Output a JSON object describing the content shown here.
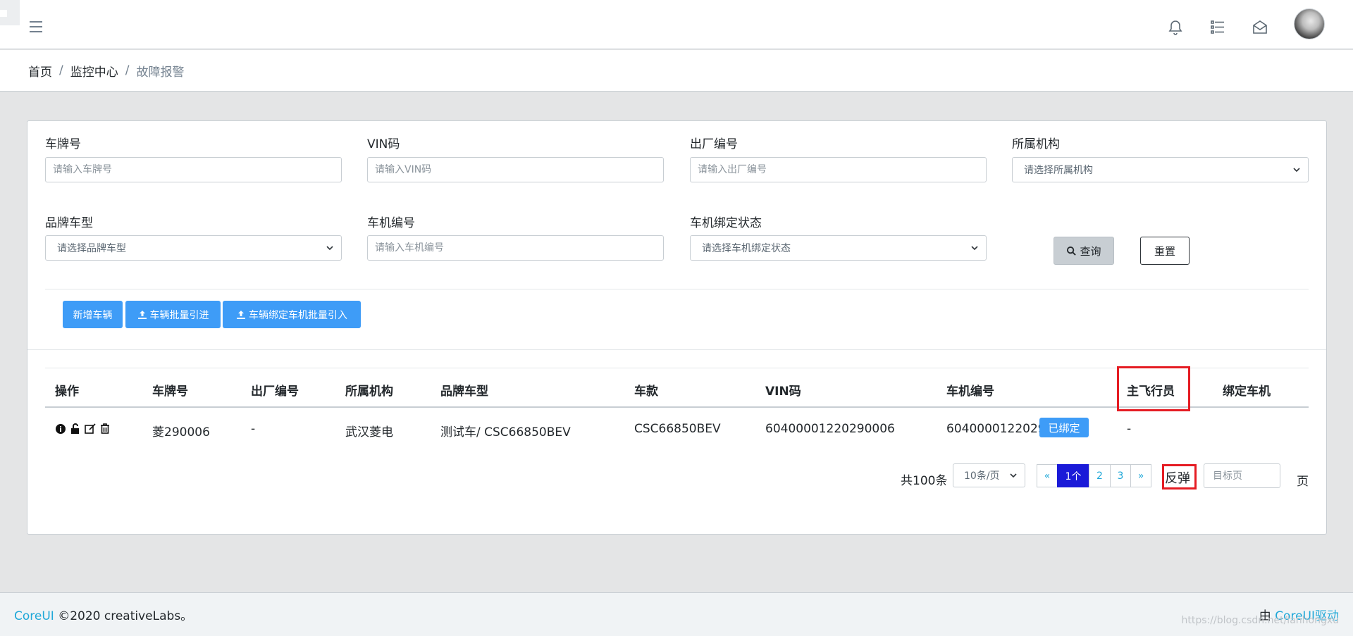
{
  "header": {
    "icons": [
      "menu-icon",
      "bell-icon",
      "list-icon",
      "envelope-icon"
    ]
  },
  "breadcrumb": {
    "home": "首页",
    "monitor": "监控中心",
    "current": "故障报警",
    "separator": "/"
  },
  "filters": {
    "plate": {
      "label": "车牌号",
      "placeholder": "请输入车牌号"
    },
    "vin": {
      "label": "VIN码",
      "placeholder": "请输入VIN码"
    },
    "factory_no": {
      "label": "出厂编号",
      "placeholder": "请输入出厂编号"
    },
    "org": {
      "label": "所属机构",
      "selected": "请选择所属机构"
    },
    "model": {
      "label": "品牌车型",
      "selected": "请选择品牌车型"
    },
    "device_no": {
      "label": "车机编号",
      "placeholder": "请输入车机编号"
    },
    "bind_status": {
      "label": "车机绑定状态",
      "selected": "请选择车机绑定状态"
    },
    "query_label": "查询",
    "reset_label": "重置"
  },
  "actions": {
    "add_vehicle": "新增车辆",
    "batch_import": "车辆批量引进",
    "bind_import": "车辆绑定车机批量引入"
  },
  "table": {
    "headers": {
      "ops": "操作",
      "plate": "车牌号",
      "factory_no": "出厂编号",
      "org": "所属机构",
      "model": "品牌车型",
      "style": "车款",
      "vin": "VIN码",
      "device_no": "车机编号",
      "pilot": "主飞行员",
      "bind": "绑定车机"
    },
    "rows": [
      {
        "plate": "菱290006",
        "factory_no": "-",
        "org": "武汉菱电",
        "model": "测试车/ CSC66850BEV",
        "style": "CSC66850BEV",
        "vin": "60400001220290006",
        "device_no": "60400001220290006",
        "pilot": "-",
        "bind": "已绑定"
      }
    ],
    "op_icons": [
      "info-icon",
      "unlock-icon",
      "edit-icon",
      "trash-icon"
    ]
  },
  "pagination": {
    "total": "共100条",
    "page_size": "10条/页",
    "prev": "«",
    "pages": [
      "1个",
      "2",
      "3"
    ],
    "next": "»",
    "rebound": "反弹",
    "goto_placeholder": "目标页",
    "suffix": "页"
  },
  "footer": {
    "brand": "CoreUI",
    "copyright": "©2020 creativeLabs。",
    "powered_prefix": "由",
    "powered_link": "CoreUI驱动"
  },
  "watermark": "https://blog.csdn.net/lanhongxu"
}
